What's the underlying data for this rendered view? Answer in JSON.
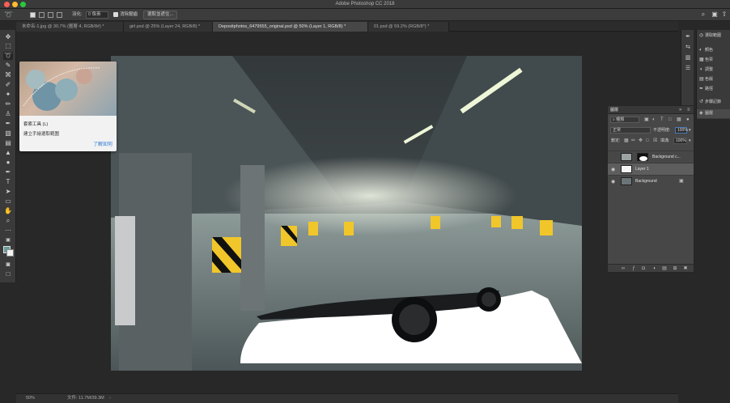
{
  "app": {
    "title": "Adobe Photoshop CC 2018"
  },
  "options_bar": {
    "feather_label": "羽化:",
    "feather_value": "0 像素",
    "antialias_label": "消除鋸齒",
    "select_mask_label": "選取並遮住..."
  },
  "tabs": [
    {
      "label": "未命名-1.jpg @ 30.7% (圖層 4, RGB/8#) *",
      "active": false
    },
    {
      "label": "girl.psd @ 25% (Layer 24, RGB/8) *",
      "active": false
    },
    {
      "label": "Depositphotos_6479555_original.psd @ 50% (Layer 1, RGB/8) *",
      "active": true
    },
    {
      "label": "01.psd @ 59.2% (RGB/8*) *",
      "active": false
    }
  ],
  "tooltip": {
    "title": "套索工具 (L)",
    "description": "建立手繪選取範圍",
    "link": "了解如何"
  },
  "right_panels": [
    {
      "label": "選取範圍",
      "icon": "circle-icon"
    },
    {
      "label": "顏色",
      "icon": "color-icon"
    },
    {
      "label": "色票",
      "icon": "swatches-icon"
    },
    {
      "label": "調整",
      "icon": "adjust-icon"
    },
    {
      "label": "色版",
      "icon": "channels-icon"
    },
    {
      "label": "路徑",
      "icon": "paths-icon"
    },
    {
      "label": "步驟記錄",
      "icon": "history-icon"
    },
    {
      "label": "圖層",
      "icon": "layers-icon",
      "active": true
    }
  ],
  "layers_panel": {
    "tab_label": "圖層",
    "filter_label": "種類",
    "blend_mode": "正常",
    "opacity_label": "不透明度:",
    "opacity_value": "100%",
    "lock_label": "鎖定:",
    "fill_label": "填滿:",
    "fill_value": "100%",
    "layers": [
      {
        "name": "Background c...",
        "visible": false,
        "selected": false
      },
      {
        "name": "Layer 1",
        "visible": true,
        "selected": true
      },
      {
        "name": "Background",
        "visible": true,
        "selected": false
      }
    ]
  },
  "status_bar": {
    "zoom": "50%",
    "doc_info": "文件: 11.7M/39.3M",
    "arrow": "›"
  },
  "colors": {
    "accent": "#4a78b8",
    "foreground_swatch": "#6a9a9a",
    "background_swatch": "#f2f2f2"
  }
}
